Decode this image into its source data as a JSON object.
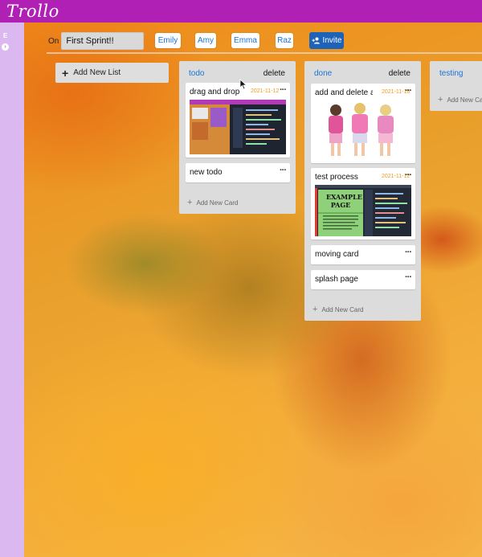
{
  "app": {
    "logo": "Trollo"
  },
  "sidebar": {
    "letter": "E",
    "toggle_icon": "chevron-right-icon"
  },
  "board": {
    "on_label": "On",
    "title": "First Sprint!!",
    "members": [
      "Emily",
      "Amy",
      "Emma",
      "Raz"
    ],
    "invite_label": "Invite",
    "add_list_label": "Add New List"
  },
  "lists": [
    {
      "title": "todo",
      "delete_label": "delete",
      "cards": [
        {
          "title": "drag and drop",
          "date": "2021-11-12",
          "image": "screenshot-thumbnail"
        },
        {
          "title": "new todo"
        }
      ],
      "add_card_label": "Add New Card"
    },
    {
      "title": "done",
      "delete_label": "delete",
      "cards": [
        {
          "title": "add and delete at...",
          "date": "2021-11-18",
          "image": "photo-thumbnail"
        },
        {
          "title": "test process",
          "date": "2021-11-12",
          "image": "example-page-thumbnail"
        },
        {
          "title": "moving card"
        },
        {
          "title": "splash page"
        }
      ],
      "add_card_label": "Add New Card"
    },
    {
      "title": "testing",
      "cards": [],
      "add_card_label": "Add New Card"
    }
  ],
  "thumbnails": {
    "example_page_title": "EXAMPLE PAGE"
  },
  "colors": {
    "topbar": "#b020b4",
    "sidebar": "#dcb8f0",
    "link": "#1a73d6",
    "invite": "#1f63b8",
    "date": "#f29a1d"
  }
}
